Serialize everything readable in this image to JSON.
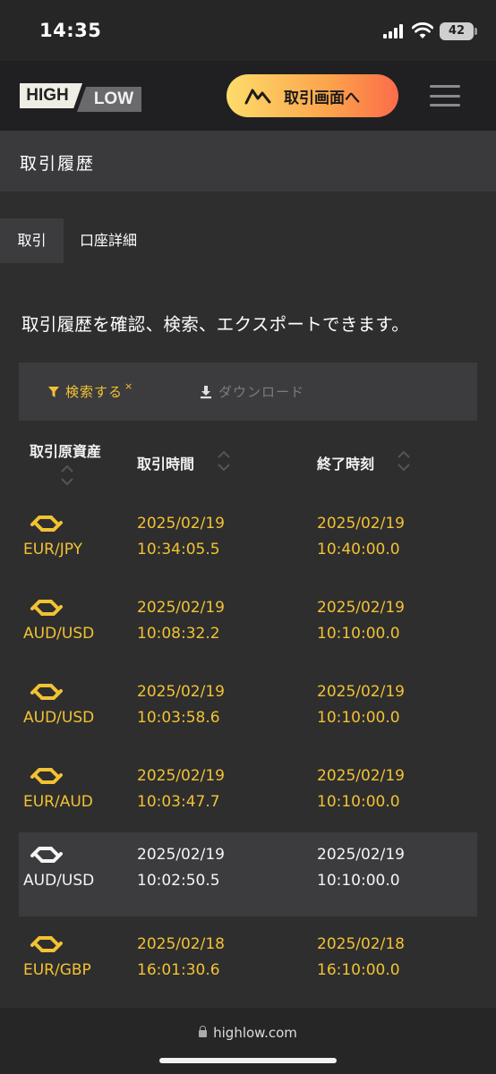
{
  "status_bar": {
    "time": "14:35",
    "battery": "42"
  },
  "header": {
    "logo_high": "HIGH",
    "logo_low": "LOW",
    "trade_button_label": "取引画面へ"
  },
  "page": {
    "title": "取引履歴"
  },
  "tabs": [
    {
      "label": "取引",
      "active": true
    },
    {
      "label": "口座詳細",
      "active": false
    }
  ],
  "intro": "取引履歴を確認、検索、エクスポートできます。",
  "toolbar": {
    "search_label": "検索する",
    "search_clear": "×",
    "download_label": "ダウンロード"
  },
  "table": {
    "columns": [
      "取引原資産",
      "取引時間",
      "終了時刻"
    ],
    "rows": [
      {
        "pair": "EUR/JPY",
        "open_date": "2025/02/19",
        "open_time": "10:34:05.5",
        "close_date": "2025/02/19",
        "close_time": "10:40:00.0",
        "status": "gold"
      },
      {
        "pair": "AUD/USD",
        "open_date": "2025/02/19",
        "open_time": "10:08:32.2",
        "close_date": "2025/02/19",
        "close_time": "10:10:00.0",
        "status": "gold"
      },
      {
        "pair": "AUD/USD",
        "open_date": "2025/02/19",
        "open_time": "10:03:58.6",
        "close_date": "2025/02/19",
        "close_time": "10:10:00.0",
        "status": "gold"
      },
      {
        "pair": "EUR/AUD",
        "open_date": "2025/02/19",
        "open_time": "10:03:47.7",
        "close_date": "2025/02/19",
        "close_time": "10:10:00.0",
        "status": "gold"
      },
      {
        "pair": "AUD/USD",
        "open_date": "2025/02/19",
        "open_time": "10:02:50.5",
        "close_date": "2025/02/19",
        "close_time": "10:10:00.0",
        "status": "white"
      },
      {
        "pair": "EUR/GBP",
        "open_date": "2025/02/18",
        "open_time": "16:01:30.6",
        "close_date": "2025/02/18",
        "close_time": "16:10:00.0",
        "status": "gold"
      }
    ]
  },
  "browser": {
    "url": "highlow.com"
  },
  "colors": {
    "gold": "#f2c233",
    "white": "#f5f5f5",
    "accent_start": "#fddc6a",
    "accent_end": "#fb6c4a"
  }
}
